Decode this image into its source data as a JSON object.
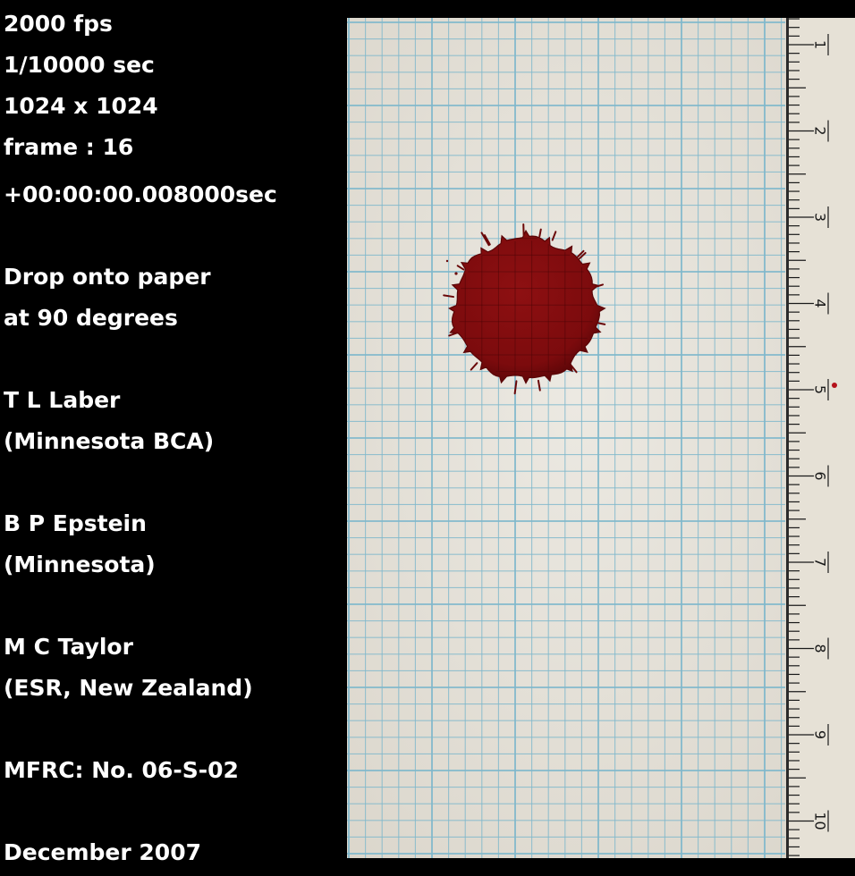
{
  "info_lines": [
    "2000 fps",
    "1/10000 sec",
    "1024 x 1024",
    "frame : 16",
    "+00:00:00.008000sec",
    "Drop onto paper",
    "at 90 degrees",
    "T L Laber",
    "(Minnesota BCA)",
    "B P Epstein",
    "(Minnesota)",
    "M C Taylor",
    "(ESR, New Zealand)",
    "MFRC:  No. 06-S-02",
    "December 2007"
  ],
  "ruler": {
    "labels": [
      "1",
      "2",
      "3",
      "4",
      "5",
      "6",
      "7",
      "8",
      "9",
      "10"
    ]
  },
  "colors": {
    "background": "#000000",
    "paper": "#e8e4dc",
    "grid": "#7fb8cc",
    "blood": "#8a0f10",
    "ruler": "#e6e1d6"
  }
}
